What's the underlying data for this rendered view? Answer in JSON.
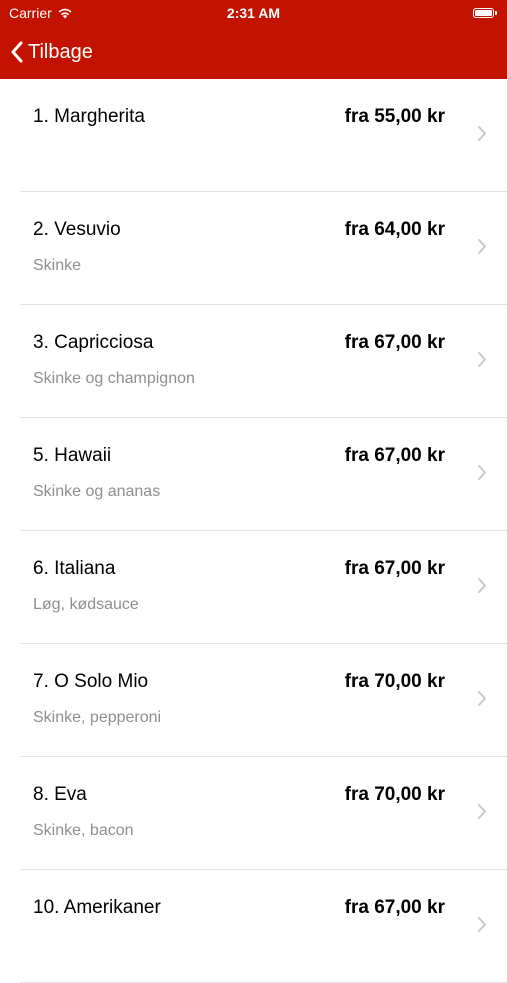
{
  "status_bar": {
    "carrier": "Carrier",
    "time": "2:31 AM",
    "icons": [
      "wifi-icon",
      "battery-icon"
    ]
  },
  "nav": {
    "back_label": "Tilbage",
    "back_icon": "chevron-left-icon"
  },
  "colors": {
    "header_bg": "#c41200",
    "header_text": "#ffffff",
    "description": "#8e8e93",
    "separator": "#e3e3e6",
    "chevron": "#c7c7cc"
  },
  "menu": {
    "items": [
      {
        "name": "1. Margherita",
        "description": "",
        "price": "fra 55,00 kr"
      },
      {
        "name": "2. Vesuvio",
        "description": "Skinke",
        "price": "fra 64,00 kr"
      },
      {
        "name": "3. Capricciosa",
        "description": "Skinke og champignon",
        "price": "fra 67,00 kr"
      },
      {
        "name": "5. Hawaii",
        "description": "Skinke og ananas",
        "price": "fra 67,00 kr"
      },
      {
        "name": "6. Italiana",
        "description": "Løg, kødsauce",
        "price": "fra 67,00 kr"
      },
      {
        "name": "7. O Solo Mio",
        "description": "Skinke, pepperoni",
        "price": "fra 70,00 kr"
      },
      {
        "name": "8. Eva",
        "description": "Skinke, bacon",
        "price": "fra 70,00 kr"
      },
      {
        "name": "10. Amerikaner",
        "description": "",
        "price": "fra 67,00 kr"
      }
    ]
  }
}
